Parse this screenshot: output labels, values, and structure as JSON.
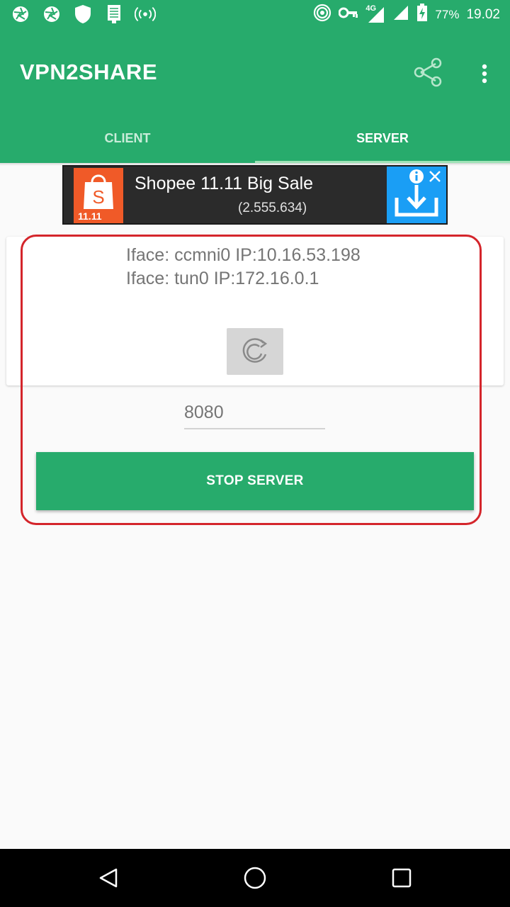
{
  "status_bar": {
    "battery_percent": "77%",
    "time": "19.02",
    "network": "4G"
  },
  "app": {
    "title": "VPN2SHARE",
    "accent_color": "#27ab6c"
  },
  "tabs": [
    {
      "label": "CLIENT",
      "selected": false
    },
    {
      "label": "SERVER",
      "selected": true
    }
  ],
  "ad": {
    "title": "Shopee 11.11 Big Sale",
    "count": "(2.555.634)",
    "logo_text": "11.11"
  },
  "server": {
    "interfaces": [
      "Iface: ccmni0 IP:10.16.53.198",
      "Iface: tun0 IP:172.16.0.1"
    ],
    "port_placeholder": "8080",
    "stop_label": "STOP SERVER"
  }
}
